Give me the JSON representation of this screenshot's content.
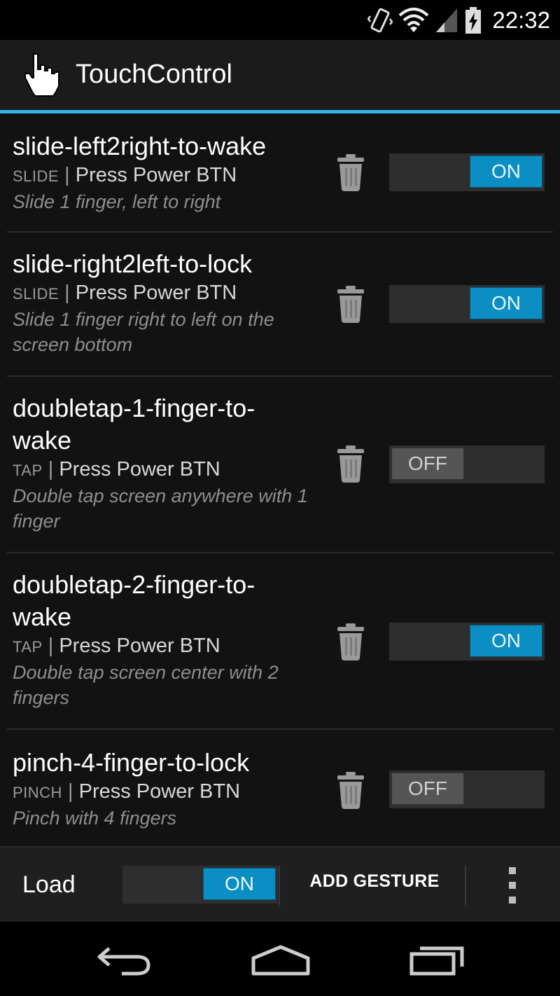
{
  "status": {
    "time": "22:32"
  },
  "app": {
    "title": "TouchControl"
  },
  "gestures": [
    {
      "name": "slide-left2right-to-wake",
      "type": "SLIDE",
      "action": "Press Power BTN",
      "description": "Slide 1 finger, left to right",
      "state": "ON"
    },
    {
      "name": "slide-right2left-to-lock",
      "type": "SLIDE",
      "action": "Press Power BTN",
      "description": "Slide 1 finger right to left on the screen bottom",
      "state": "ON"
    },
    {
      "name": "doubletap-1-finger-to-wake",
      "type": "TAP",
      "action": "Press Power BTN",
      "description": "Double tap screen anywhere with 1 finger",
      "state": "OFF"
    },
    {
      "name": "doubletap-2-finger-to-wake",
      "type": "TAP",
      "action": "Press Power BTN",
      "description": "Double tap screen center with 2 fingers",
      "state": "ON"
    },
    {
      "name": "pinch-4-finger-to-lock",
      "type": "PINCH",
      "action": "Press Power BTN",
      "description": "Pinch with 4 fingers",
      "state": "OFF"
    }
  ],
  "bottom_bar": {
    "load_label": "Load",
    "load_state": "ON",
    "add_gesture_label": "ADD GESTURE"
  },
  "colors": {
    "accent": "#33b5e5",
    "toggle_on": "#0a8ec4",
    "toggle_off": "#555555"
  },
  "icons": {
    "status": [
      "vibrate-icon",
      "wifi-icon",
      "signal-icon",
      "battery-charging-icon"
    ],
    "app": "hand-pointer-icon",
    "row": "trash-icon",
    "overflow": "overflow-menu-icon",
    "nav": [
      "back-icon",
      "home-icon",
      "recents-icon"
    ]
  }
}
